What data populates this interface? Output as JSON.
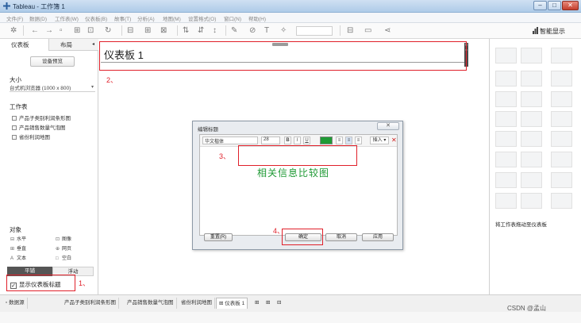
{
  "window": {
    "title": "Tableau - 工作簿 1",
    "min": "–",
    "max": "□",
    "close": "✕"
  },
  "menu": [
    "文件(F)",
    "数据(D)",
    "工作表(W)",
    "仪表板(B)",
    "故事(T)",
    "分析(A)",
    "地图(M)",
    "设置格式(O)",
    "窗口(N)",
    "帮助(H)"
  ],
  "toolbar": {
    "show_me": "智能显示",
    "icons": [
      "tableau-icon",
      "back-icon",
      "forward-icon",
      "save-icon",
      "add-datasource-icon",
      "new-sheet-icon",
      "redo-icon",
      "chart-icon",
      "swap-icon",
      "filter-icon",
      "sort-asc-icon",
      "sort-desc-icon",
      "highlight-icon",
      "group-icon",
      "label-icon",
      "pin-icon",
      "fit-icon",
      "presentation-icon",
      "share-icon"
    ]
  },
  "left_panel": {
    "tab_dashboard": "仪表板",
    "tab_layout": "布局",
    "device_preview": "设备预览",
    "size_label": "大小",
    "size_value": "台式机浏览器 (1000 x 800)",
    "worksheets_label": "工作表",
    "worksheets": [
      "产品子类别利润条形图",
      "产品销售数量气泡图",
      "省份利润地图"
    ],
    "objects_label": "对象",
    "objects": [
      {
        "icon": "⊟",
        "label": "水平"
      },
      {
        "icon": "⊡",
        "label": "图像"
      },
      {
        "icon": "⊞",
        "label": "垂直"
      },
      {
        "icon": "⊕",
        "label": "网页"
      },
      {
        "icon": "A",
        "label": "文本"
      },
      {
        "icon": "□",
        "label": "空白"
      }
    ],
    "tile": "平铺",
    "float": "浮动",
    "show_title_checkbox": "显示仪表板标题",
    "show_title_checked": "✓"
  },
  "annotations": {
    "a1": "1、",
    "a2": "2、",
    "a3": "3、",
    "a4": "4、"
  },
  "canvas": {
    "title": "仪表板 1"
  },
  "dialog": {
    "title": "编辑标题",
    "close": "✕",
    "font": "华文楷体",
    "font_size": "28",
    "bold": "B",
    "italic": "I",
    "underline": "U",
    "align_left": "≡",
    "align_center": "≡",
    "align_right": "≡",
    "insert": "插入 ▾",
    "clear": "✕",
    "content": "相关信息比较图",
    "reset": "重置(R)",
    "ok": "确定",
    "cancel": "取消",
    "apply": "应用"
  },
  "right_panel": {
    "hint": "将工作表拖动至仪表板"
  },
  "bottom_tabs": [
    "数据源",
    "产品子类别利润条形图",
    "产品销售数量气泡图",
    "省份利润地图",
    "仪表板 1"
  ],
  "watermark": "CSDN @孟山"
}
